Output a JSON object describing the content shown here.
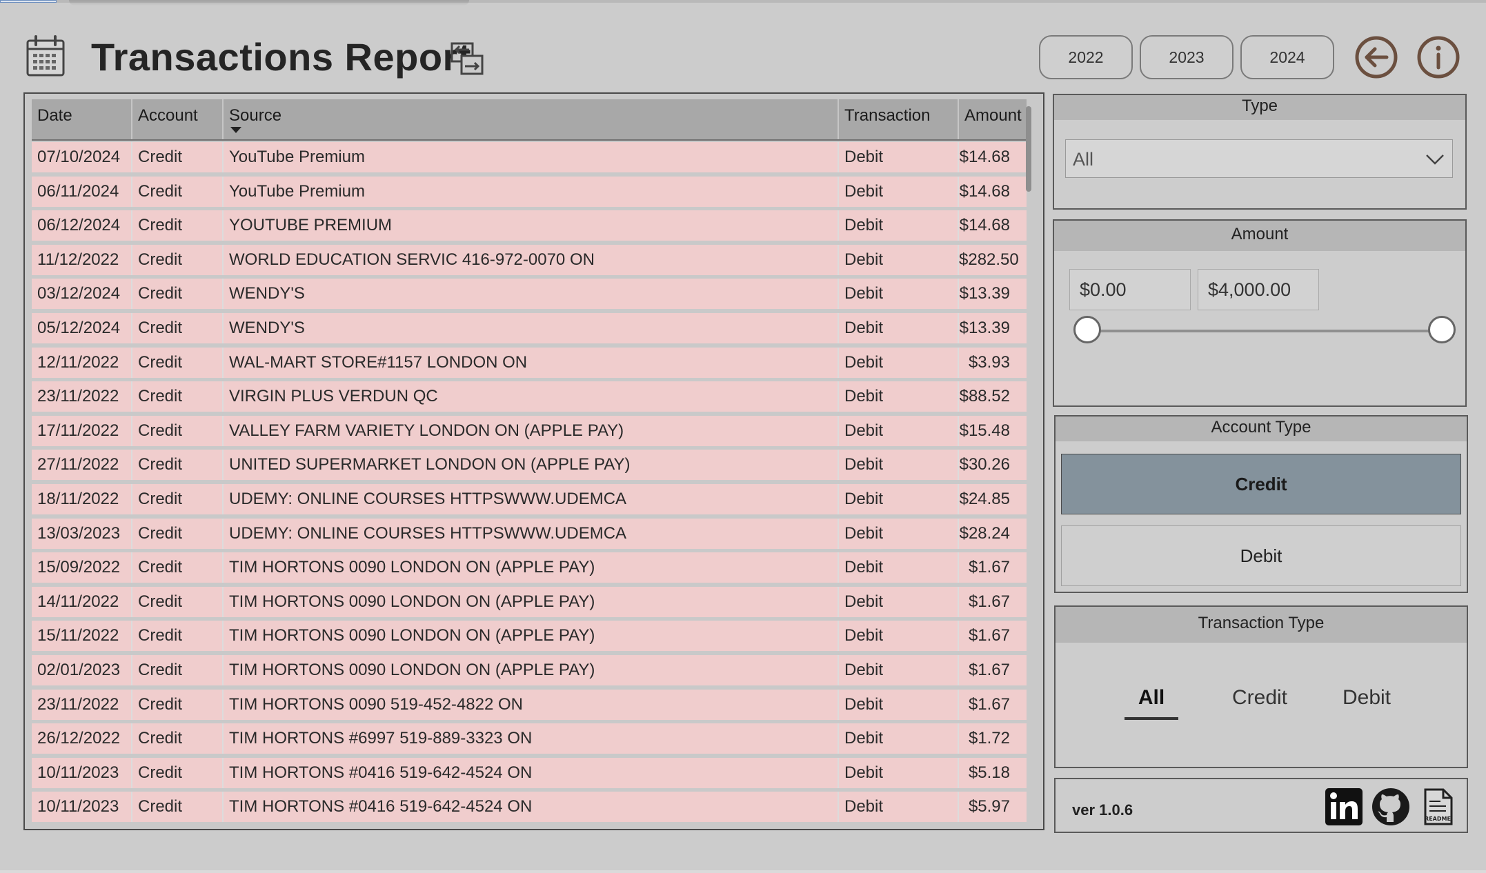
{
  "header": {
    "title": "Transactions Report",
    "years": [
      "2022",
      "2023",
      "2024"
    ]
  },
  "table": {
    "columns": [
      "Date",
      "Account",
      "Source",
      "Transaction",
      "Amount"
    ],
    "sorted_column": "Source",
    "row_color": "#f0cdcd",
    "rows": [
      [
        "07/10/2024",
        "Credit",
        "YouTube Premium",
        "Debit",
        "$14.68"
      ],
      [
        "06/11/2024",
        "Credit",
        "YouTube Premium",
        "Debit",
        "$14.68"
      ],
      [
        "06/12/2024",
        "Credit",
        "YOUTUBE PREMIUM",
        "Debit",
        "$14.68"
      ],
      [
        "11/12/2022",
        "Credit",
        "WORLD EDUCATION SERVIC 416-972-0070 ON",
        "Debit",
        "$282.50"
      ],
      [
        "03/12/2024",
        "Credit",
        "WENDY'S",
        "Debit",
        "$13.39"
      ],
      [
        "05/12/2024",
        "Credit",
        "WENDY'S",
        "Debit",
        "$13.39"
      ],
      [
        "12/11/2022",
        "Credit",
        "WAL-MART STORE#1157 LONDON ON",
        "Debit",
        "$3.93"
      ],
      [
        "23/11/2022",
        "Credit",
        "VIRGIN PLUS VERDUN QC",
        "Debit",
        "$88.52"
      ],
      [
        "17/11/2022",
        "Credit",
        "VALLEY FARM VARIETY LONDON ON (APPLE PAY)",
        "Debit",
        "$15.48"
      ],
      [
        "27/11/2022",
        "Credit",
        "UNITED SUPERMARKET LONDON ON (APPLE PAY)",
        "Debit",
        "$30.26"
      ],
      [
        "18/11/2022",
        "Credit",
        "UDEMY: ONLINE COURSES HTTPSWWW.UDEMCA",
        "Debit",
        "$24.85"
      ],
      [
        "13/03/2023",
        "Credit",
        "UDEMY: ONLINE COURSES HTTPSWWW.UDEMCA",
        "Debit",
        "$28.24"
      ],
      [
        "15/09/2022",
        "Credit",
        "TIM HORTONS 0090 LONDON ON (APPLE PAY)",
        "Debit",
        "$1.67"
      ],
      [
        "14/11/2022",
        "Credit",
        "TIM HORTONS 0090 LONDON ON (APPLE PAY)",
        "Debit",
        "$1.67"
      ],
      [
        "15/11/2022",
        "Credit",
        "TIM HORTONS 0090 LONDON ON (APPLE PAY)",
        "Debit",
        "$1.67"
      ],
      [
        "02/01/2023",
        "Credit",
        "TIM HORTONS 0090 LONDON ON (APPLE PAY)",
        "Debit",
        "$1.67"
      ],
      [
        "23/11/2022",
        "Credit",
        "TIM HORTONS 0090 519-452-4822 ON",
        "Debit",
        "$1.67"
      ],
      [
        "26/12/2022",
        "Credit",
        "TIM HORTONS #6997 519-889-3323 ON",
        "Debit",
        "$1.72"
      ],
      [
        "10/11/2023",
        "Credit",
        "TIM HORTONS #0416 519-642-4524 ON",
        "Debit",
        "$5.18"
      ],
      [
        "10/11/2023",
        "Credit",
        "TIM HORTONS #0416 519-642-4524 ON",
        "Debit",
        "$5.97"
      ]
    ]
  },
  "filters": {
    "type": {
      "title": "Type",
      "selected": "All"
    },
    "amount": {
      "title": "Amount",
      "min": "$0.00",
      "max": "$4,000.00",
      "range_low": 0,
      "range_high": 1
    },
    "account_type": {
      "title": "Account Type",
      "options": [
        "Credit",
        "Debit"
      ],
      "selected": "Credit",
      "selected_color": "#84929c"
    },
    "transaction_type": {
      "title": "Transaction Type",
      "options": [
        "All",
        "Credit",
        "Debit"
      ],
      "selected": "All"
    }
  },
  "footer": {
    "version": "ver 1.0.6",
    "icons": [
      "linkedin-icon",
      "github-icon",
      "readme-icon"
    ],
    "readme_icon_text": "README"
  }
}
